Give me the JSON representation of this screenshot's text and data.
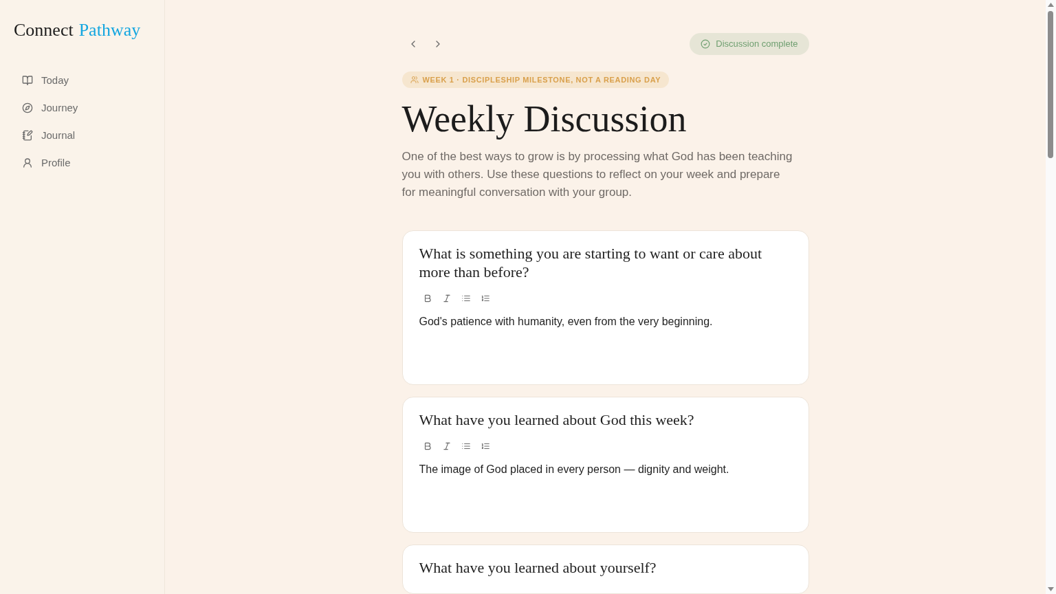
{
  "sidebar": {
    "logo": {
      "text": "Connect",
      "accent": "Pathway"
    },
    "items": [
      {
        "label": "Today",
        "selected": false
      },
      {
        "label": "Journey",
        "selected": false
      },
      {
        "label": "Journal",
        "selected": false
      },
      {
        "label": "Profile",
        "selected": false
      }
    ]
  },
  "header": {
    "status": "Discussion complete",
    "badge": "WEEK 1 · DISCIPLESHIP MILESTONE, NOT A READING DAY",
    "title": "Weekly Discussion",
    "intro": "One of the best ways to grow is by processing what God has been teaching you with others. Use these questions to reflect on your week and prepare for meaningful conversation with your group."
  },
  "questions": [
    {
      "question": "What is something you are starting to want or care about more than before?",
      "answer": "God's patience with humanity, even from the very beginning."
    },
    {
      "question": "What have you learned about God this week?",
      "answer": "The image of God placed in every person — dignity and weight."
    },
    {
      "question": "What have you learned about yourself?"
    }
  ]
}
